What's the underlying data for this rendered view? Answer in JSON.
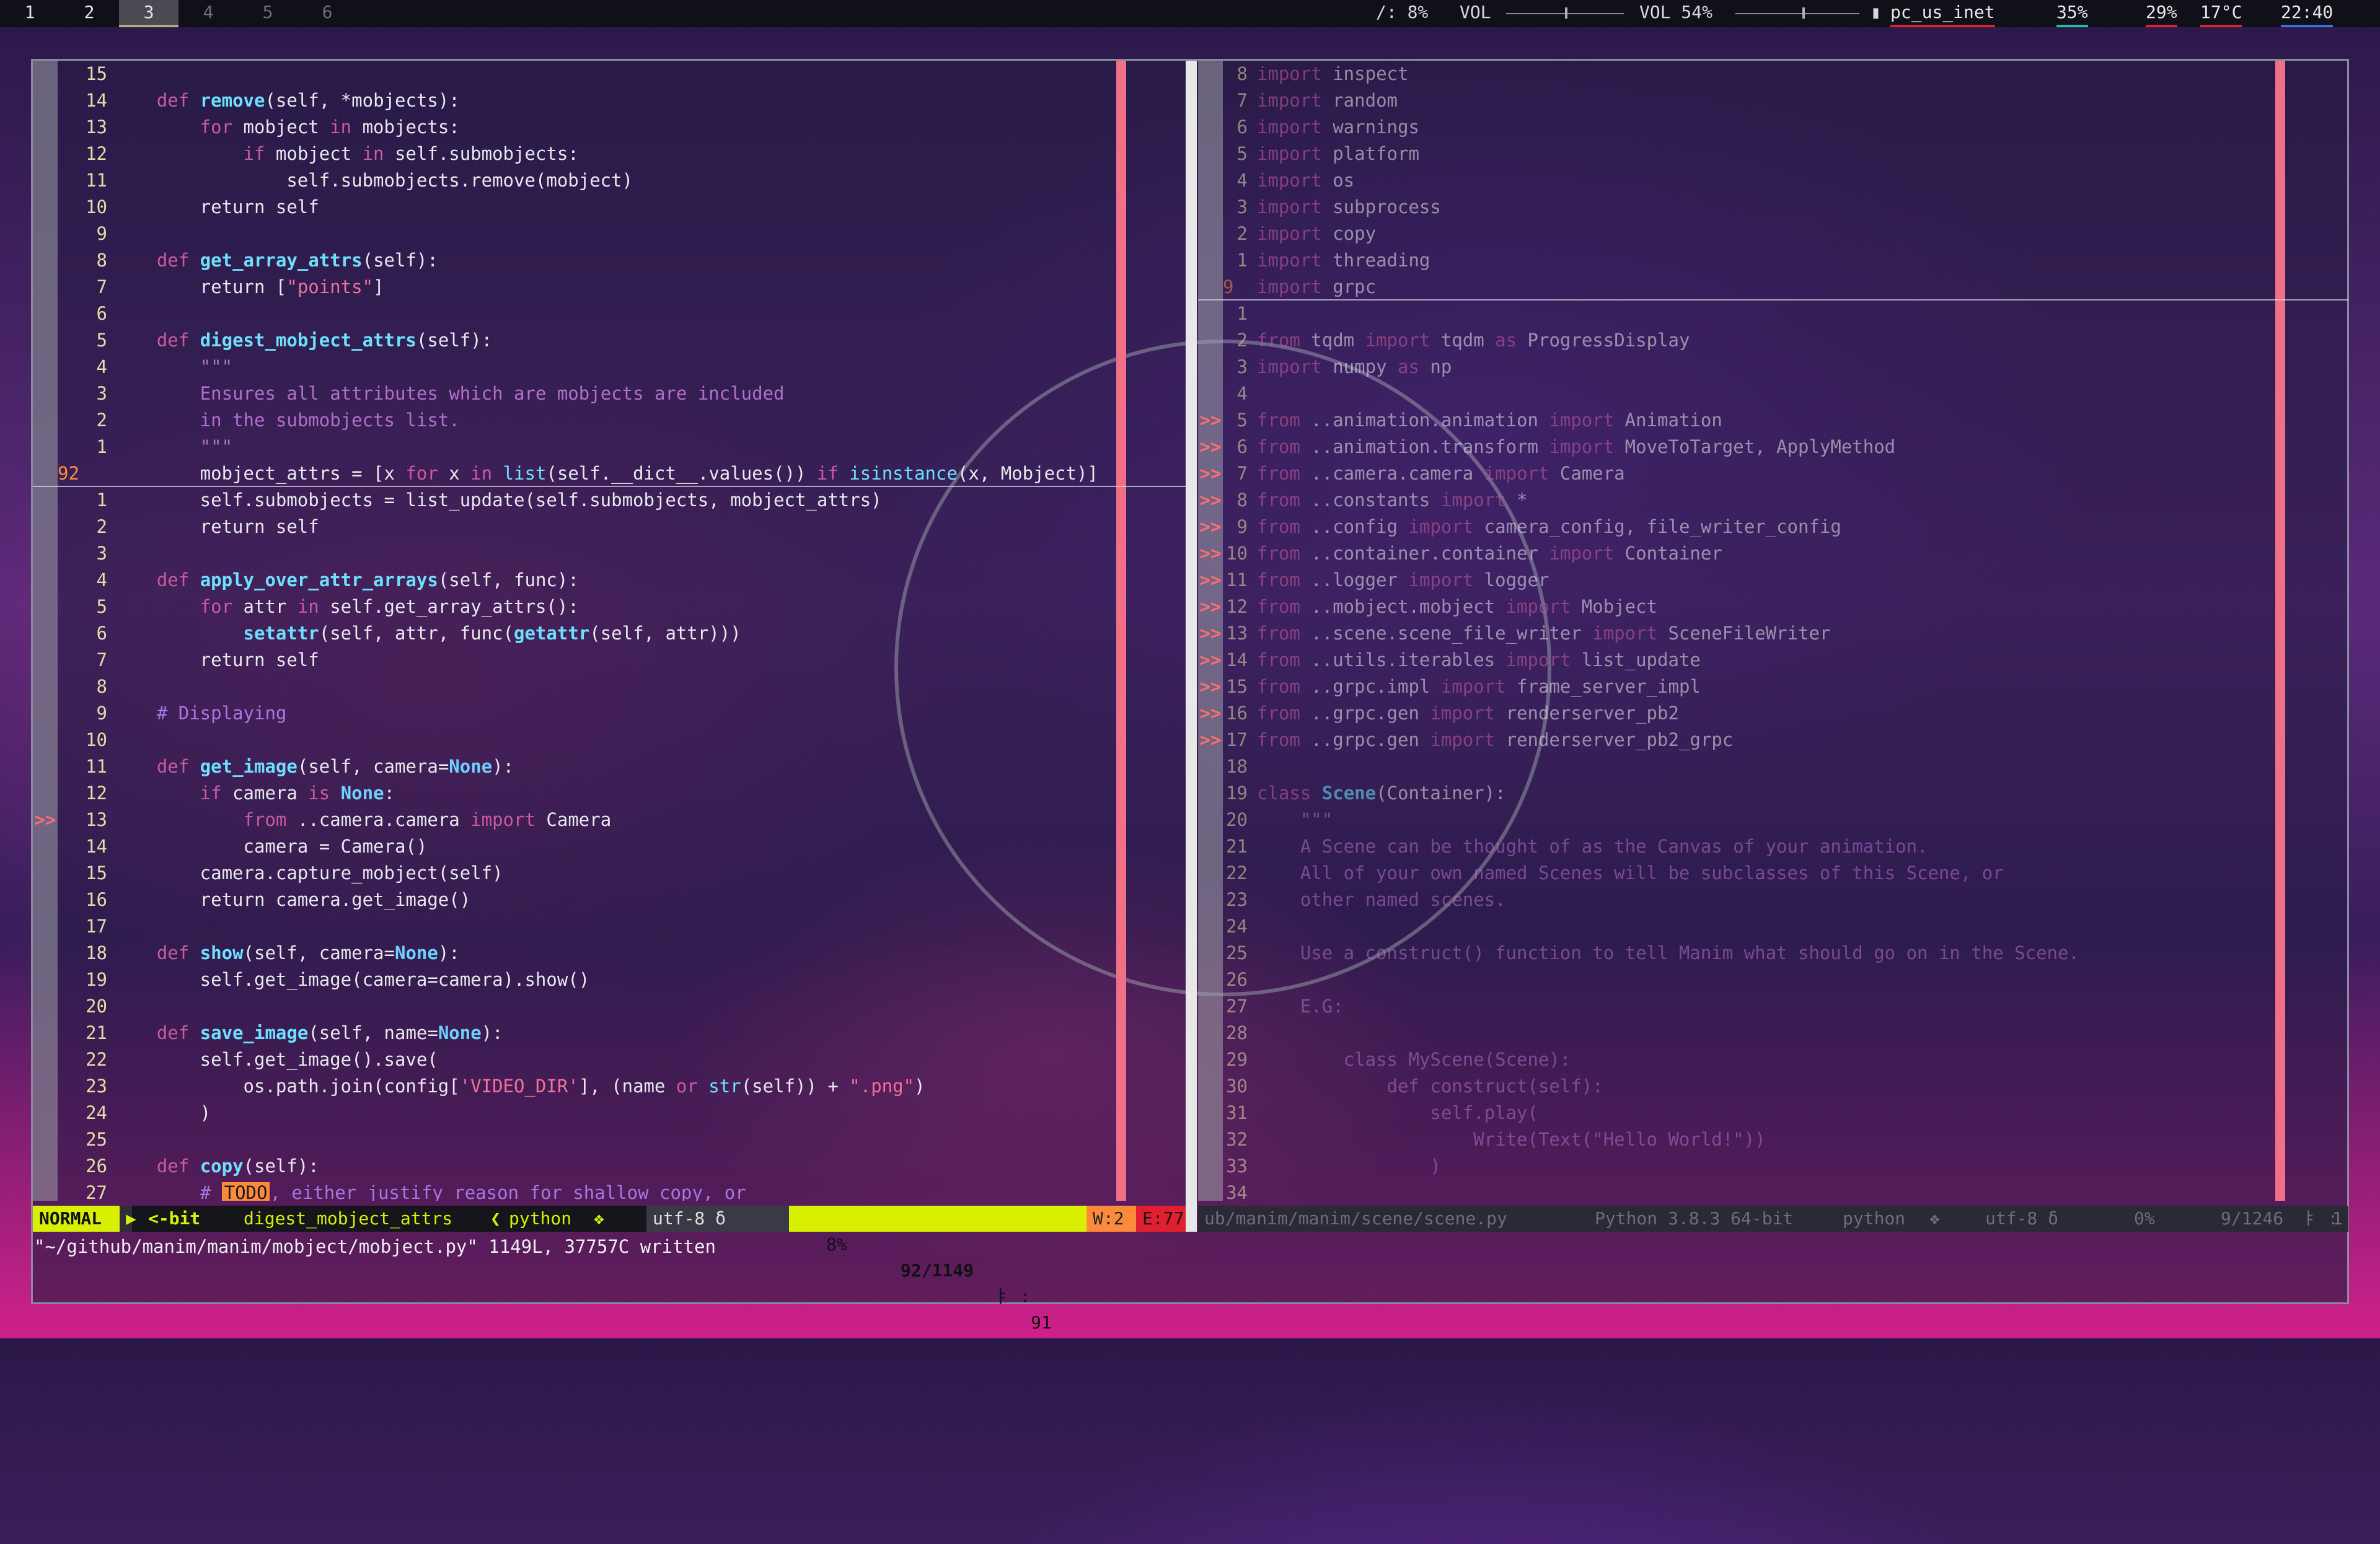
{
  "bar": {
    "workspaces": [
      "1",
      "2",
      "3",
      "4",
      "5",
      "6"
    ],
    "active_workspace": "3",
    "cpu": "/: 8%",
    "vol_label_1": "VOL",
    "vol_label_2": "VOL 54%",
    "vol_level_1": 0.5,
    "vol_level_2": 0.54,
    "network": "pc_us_inet",
    "stat1": "35%",
    "stat2": "29%",
    "temp": "17°C",
    "clock": "22:40"
  },
  "left_pane": {
    "lines": [
      {
        "n": "15",
        "html": ""
      },
      {
        "n": "14",
        "html": "    <span class=kw>def</span> <span class=fn>remove</span>(self, *mobjects):"
      },
      {
        "n": "13",
        "html": "        <span class=kw>for</span> mobject <span class=kw>in</span> mobjects:"
      },
      {
        "n": "12",
        "html": "            <span class=kw>if</span> mobject <span class=kw>in</span> self.submobjects:"
      },
      {
        "n": "11",
        "html": "                self.submobjects.remove(mobject)"
      },
      {
        "n": "10",
        "html": "        return self"
      },
      {
        "n": "9",
        "html": ""
      },
      {
        "n": "8",
        "html": "    <span class=kw>def</span> <span class=fn>get_array_attrs</span>(self):"
      },
      {
        "n": "7",
        "html": "        return [<span class=st>\"points\"</span>]"
      },
      {
        "n": "6",
        "html": ""
      },
      {
        "n": "5",
        "html": "    <span class=kw>def</span> <span class=fn>digest_mobject_attrs</span>(self):"
      },
      {
        "n": "4",
        "html": "        <span class=dc>\"\"\"</span>"
      },
      {
        "n": "3",
        "html": "        <span class=dc>Ensures all attributes which are mobjects are included</span>"
      },
      {
        "n": "2",
        "html": "        <span class=dc>in the submobjects list.</span>"
      },
      {
        "n": "1",
        "html": "        <span class=dc>\"\"\"</span>"
      },
      {
        "n": "92",
        "cur": true,
        "html": "        mobject_attrs = [x <span class=kw>for</span> x <span class=kw>in</span> <span class=bt>list</span>(self.__dict__.values()) <span class=kw>if</span> <span class=bt>isinstance</span>(x, Mobject)]"
      },
      {
        "n": "1",
        "html": "        self.submobjects = list_update(self.submobjects, mobject_attrs)"
      },
      {
        "n": "2",
        "html": "        return self"
      },
      {
        "n": "3",
        "html": ""
      },
      {
        "n": "4",
        "html": "    <span class=kw>def</span> <span class=fn>apply_over_attr_arrays</span>(self, func):"
      },
      {
        "n": "5",
        "html": "        <span class=kw>for</span> attr <span class=kw>in</span> self.get_array_attrs():"
      },
      {
        "n": "6",
        "html": "            <span class=fn>setattr</span>(self, attr, func(<span class=fn>getattr</span>(self, attr)))"
      },
      {
        "n": "7",
        "html": "        return self"
      },
      {
        "n": "8",
        "html": ""
      },
      {
        "n": "9",
        "html": "    <span class=cm># Displaying</span>"
      },
      {
        "n": "10",
        "html": ""
      },
      {
        "n": "11",
        "html": "    <span class=kw>def</span> <span class=fn>get_image</span>(self, camera=<span class=cn>None</span>):"
      },
      {
        "n": "12",
        "html": "        <span class=kw>if</span> camera <span class=kw>is</span> <span class=cn>None</span>:"
      },
      {
        "n": "13",
        "sign": ">>",
        "html": "            <span class=kw>from</span> ..camera.camera <span class=kw>import</span> Camera"
      },
      {
        "n": "14",
        "html": "            camera = Camera()"
      },
      {
        "n": "15",
        "html": "        camera.capture_mobject(self)"
      },
      {
        "n": "16",
        "html": "        return camera.get_image()"
      },
      {
        "n": "17",
        "html": ""
      },
      {
        "n": "18",
        "html": "    <span class=kw>def</span> <span class=fn>show</span>(self, camera=<span class=cn>None</span>):"
      },
      {
        "n": "19",
        "html": "        self.get_image(camera=camera).show()"
      },
      {
        "n": "20",
        "html": ""
      },
      {
        "n": "21",
        "html": "    <span class=kw>def</span> <span class=fn>save_image</span>(self, name=<span class=cn>None</span>):"
      },
      {
        "n": "22",
        "html": "        self.get_image().save("
      },
      {
        "n": "23",
        "html": "            os.path.join(config[<span class=st>'VIDEO_DIR'</span>], (name <span class=kw>or</span> <span class=bt>str</span>(self)) + <span class=st>\".png\"</span>)"
      },
      {
        "n": "24",
        "html": "        )"
      },
      {
        "n": "25",
        "html": ""
      },
      {
        "n": "26",
        "html": "    <span class=kw>def</span> <span class=fn>copy</span>(self):"
      },
      {
        "n": "27",
        "html": "        <span class=cm># <span class=todo>TODO</span>, either justify reason for shallow copy, or</span>"
      }
    ],
    "status": {
      "mode": "NORMAL",
      "branch": "<-bit",
      "func": "digest_mobject_attrs",
      "lang": "python",
      "enc": "utf-8",
      "pct": "8%",
      "pos": "92/1149",
      "col": "91",
      "warn": "W:2",
      "err": "E:77"
    }
  },
  "right_pane": {
    "lines": [
      {
        "n": "8",
        "html": "<span class=kw>import</span> inspect"
      },
      {
        "n": "7",
        "html": "<span class=kw>import</span> random"
      },
      {
        "n": "6",
        "html": "<span class=kw>import</span> warnings"
      },
      {
        "n": "5",
        "html": "<span class=kw>import</span> platform"
      },
      {
        "n": "4",
        "html": "<span class=kw>import</span> os"
      },
      {
        "n": "3",
        "html": "<span class=kw>import</span> subprocess"
      },
      {
        "n": "2",
        "html": "<span class=kw>import</span> copy"
      },
      {
        "n": "1",
        "html": "<span class=kw>import</span> threading"
      },
      {
        "n": "9",
        "cur": true,
        "html": "<span class=kw>import</span> grpc"
      },
      {
        "n": "1",
        "html": ""
      },
      {
        "n": "2",
        "html": "<span class=kw>from</span> tqdm <span class=kw>import</span> tqdm <span class=kw>as</span> ProgressDisplay"
      },
      {
        "n": "3",
        "html": "<span class=kw>import</span> numpy <span class=kw>as</span> np"
      },
      {
        "n": "4",
        "html": ""
      },
      {
        "n": "5",
        "sign": ">>",
        "html": "<span class=kw>from</span> ..animation.animation <span class=kw>import</span> Animation"
      },
      {
        "n": "6",
        "sign": ">>",
        "html": "<span class=kw>from</span> ..animation.transform <span class=kw>import</span> MoveToTarget, ApplyMethod"
      },
      {
        "n": "7",
        "sign": ">>",
        "html": "<span class=kw>from</span> ..camera.camera <span class=kw>import</span> Camera"
      },
      {
        "n": "8",
        "sign": ">>",
        "html": "<span class=kw>from</span> ..constants <span class=kw>import</span> *"
      },
      {
        "n": "9",
        "sign": ">>",
        "html": "<span class=kw>from</span> ..config <span class=kw>import</span> camera_config, file_writer_config"
      },
      {
        "n": "10",
        "sign": ">>",
        "html": "<span class=kw>from</span> ..container.container <span class=kw>import</span> Container"
      },
      {
        "n": "11",
        "sign": ">>",
        "html": "<span class=kw>from</span> ..logger <span class=kw>import</span> logger"
      },
      {
        "n": "12",
        "sign": ">>",
        "html": "<span class=kw>from</span> ..mobject.mobject <span class=kw>import</span> Mobject"
      },
      {
        "n": "13",
        "sign": ">>",
        "html": "<span class=kw>from</span> ..scene.scene_file_writer <span class=kw>import</span> SceneFileWriter"
      },
      {
        "n": "14",
        "sign": ">>",
        "html": "<span class=kw>from</span> ..utils.iterables <span class=kw>import</span> list_update"
      },
      {
        "n": "15",
        "sign": ">>",
        "html": "<span class=kw>from</span> ..grpc.impl <span class=kw>import</span> frame_server_impl"
      },
      {
        "n": "16",
        "sign": ">>",
        "html": "<span class=kw>from</span> ..grpc.gen <span class=kw>import</span> renderserver_pb2"
      },
      {
        "n": "17",
        "sign": ">>",
        "html": "<span class=kw>from</span> ..grpc.gen <span class=kw>import</span> renderserver_pb2_grpc"
      },
      {
        "n": "18",
        "html": ""
      },
      {
        "n": "19",
        "html": "<span class=kw>class</span> <span class=fn>Scene</span>(Container):"
      },
      {
        "n": "20",
        "html": "    <span class=dc>\"\"\"</span>"
      },
      {
        "n": "21",
        "html": "    <span class=dc>A Scene can be thought of as the Canvas of your animation.</span>"
      },
      {
        "n": "22",
        "html": "    <span class=dc>All of your own named Scenes will be subclasses of this Scene, or</span>"
      },
      {
        "n": "23",
        "html": "    <span class=dc>other named scenes.</span>"
      },
      {
        "n": "24",
        "html": ""
      },
      {
        "n": "25",
        "html": "    <span class=dc>Use a construct() function to tell Manim what should go on in the Scene.</span>"
      },
      {
        "n": "26",
        "html": ""
      },
      {
        "n": "27",
        "html": "    <span class=dc>E.G:</span>"
      },
      {
        "n": "28",
        "html": ""
      },
      {
        "n": "29",
        "html": "        <span class=dc>class MyScene(Scene):</span>"
      },
      {
        "n": "30",
        "html": "            <span class=dc>def construct(self):</span>"
      },
      {
        "n": "31",
        "html": "                <span class=dc>self.play(</span>"
      },
      {
        "n": "32",
        "html": "                    <span class=dc>Write(Text(\"Hello World!\"))</span>"
      },
      {
        "n": "33",
        "html": "                <span class=dc>)</span>"
      },
      {
        "n": "34",
        "html": ""
      }
    ],
    "status": {
      "file": "ub/manim/manim/scene/scene.py",
      "env": "Python 3.8.3 64-bit",
      "lang": "python",
      "enc": "utf-8",
      "pct": "0%",
      "pos": "9/1246",
      "col": "1"
    }
  },
  "cmdline": "\"~/github/manim/manim/mobject/mobject.py\" 1149L, 37757C written"
}
